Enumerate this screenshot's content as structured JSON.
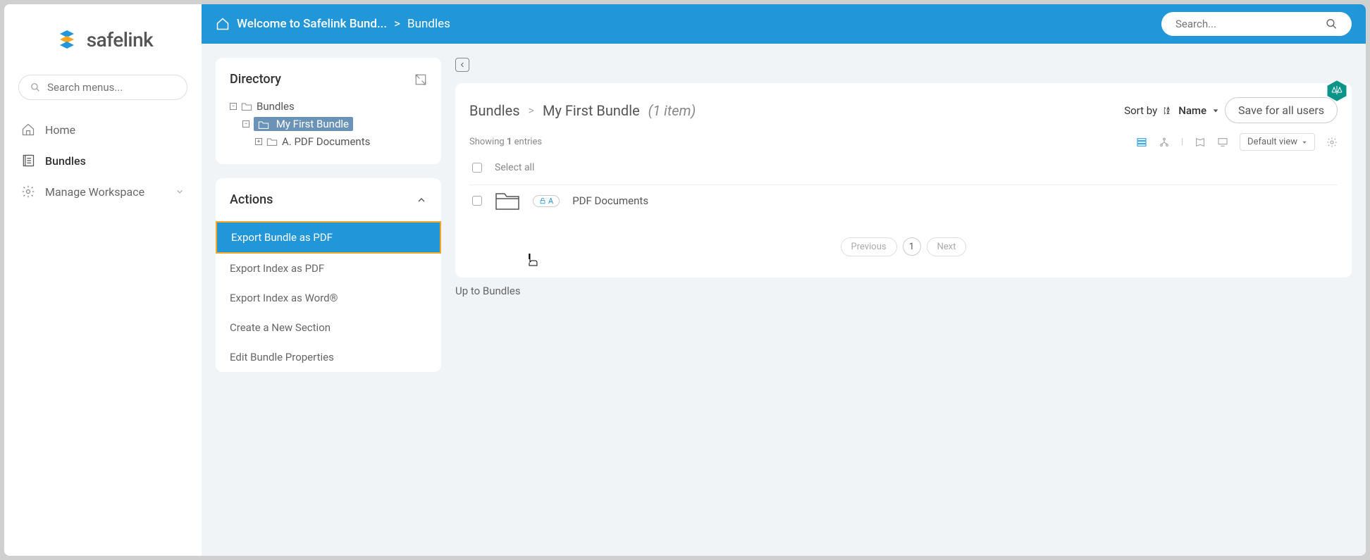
{
  "logo_text": "safelink",
  "sidebar_search_placeholder": "Search menus...",
  "nav": {
    "home": "Home",
    "bundles": "Bundles",
    "manage": "Manage Workspace"
  },
  "topbar": {
    "crumb1": "Welcome to Safelink Bund...",
    "sep": ">",
    "crumb2": "Bundles",
    "search_placeholder": "Search..."
  },
  "directory": {
    "title": "Directory",
    "root": "Bundles",
    "child1": "My First Bundle",
    "child2": "A. PDF Documents"
  },
  "actions": {
    "title": "Actions",
    "items": [
      "Export Bundle as PDF",
      "Export Index as PDF",
      "Export Index as Word®",
      "Create a New Section",
      "Edit Bundle Properties"
    ]
  },
  "main": {
    "crumb_root": "Bundles",
    "crumb_sep": ">",
    "crumb_current": "My First Bundle",
    "crumb_count": "(1 item)",
    "sort_label": "Sort by",
    "sort_value": "Name",
    "save_btn": "Save for all users",
    "showing_prefix": "Showing",
    "showing_count": "1",
    "showing_suffix": "entries",
    "view_label": "Default view",
    "select_all": "Select all",
    "item_badge": "A",
    "item_name": "PDF Documents",
    "prev": "Previous",
    "page": "1",
    "next": "Next",
    "up_link": "Up to Bundles"
  }
}
